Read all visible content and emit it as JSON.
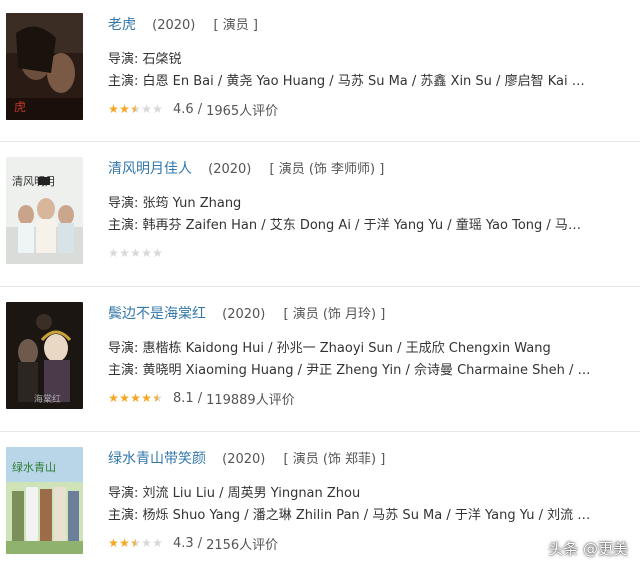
{
  "movies": [
    {
      "title": "老虎",
      "year": "(2020)",
      "role": "[ 演员 ]",
      "director": "导演: 石棨锐",
      "cast": "主演: 白恩 En Bai / 黄尧 Yao Huang / 马苏 Su Ma / 苏鑫 Xin Su / 廖启智 Kai Chi...",
      "stars": [
        "on",
        "on",
        "half",
        "off",
        "off"
      ],
      "score": "4.6",
      "votes": "1965人评价",
      "show_rating_text": true
    },
    {
      "title": "清风明月佳人",
      "year": "(2020)",
      "role": "[ 演员 (饰 李师师) ]",
      "director": "导演: 张筠 Yun Zhang",
      "cast": "主演: 韩再芬 Zaifen Han / 艾东 Dong Ai / 于洋 Yang Yu / 童瑶 Yao Tong / 马苏 S...",
      "stars": [
        "off",
        "off",
        "off",
        "off",
        "off"
      ],
      "score": "",
      "votes": "",
      "show_rating_text": false
    },
    {
      "title": "鬓边不是海棠红",
      "year": "(2020)",
      "role": "[ 演员 (饰 月玲) ]",
      "director": "导演: 惠楷栋 Kaidong Hui / 孙兆一 Zhaoyi Sun / 王成欣 Chengxin Wang",
      "cast": "主演: 黄晓明 Xiaoming Huang / 尹正 Zheng Yin / 佘诗曼 Charmaine Sheh / 米热 Me...",
      "stars": [
        "on",
        "on",
        "on",
        "on",
        "half"
      ],
      "score": "8.1",
      "votes": "119889人评价",
      "show_rating_text": true
    },
    {
      "title": "绿水青山带笑颜",
      "year": "(2020)",
      "role": "[ 演员 (饰 郑菲) ]",
      "director": "导演: 刘流 Liu Liu / 周英男 Yingnan Zhou",
      "cast": "主演: 杨烁 Shuo Yang / 潘之琳 Zhilin Pan / 马苏 Su Ma / 于洋 Yang Yu / 刘流 Li...",
      "stars": [
        "on",
        "on",
        "half",
        "off",
        "off"
      ],
      "score": "4.3",
      "votes": "2156人评价",
      "show_rating_text": true
    }
  ],
  "poster_icons": [
    "poster-tiger-icon",
    "poster-costume-drama-icon",
    "poster-opera-drama-icon",
    "poster-countryside-drama-icon"
  ],
  "watermark": "头条 @更美",
  "colors": {
    "title": "#3377aa",
    "star_on": "#f5a623",
    "star_off": "#d8d8d8"
  }
}
